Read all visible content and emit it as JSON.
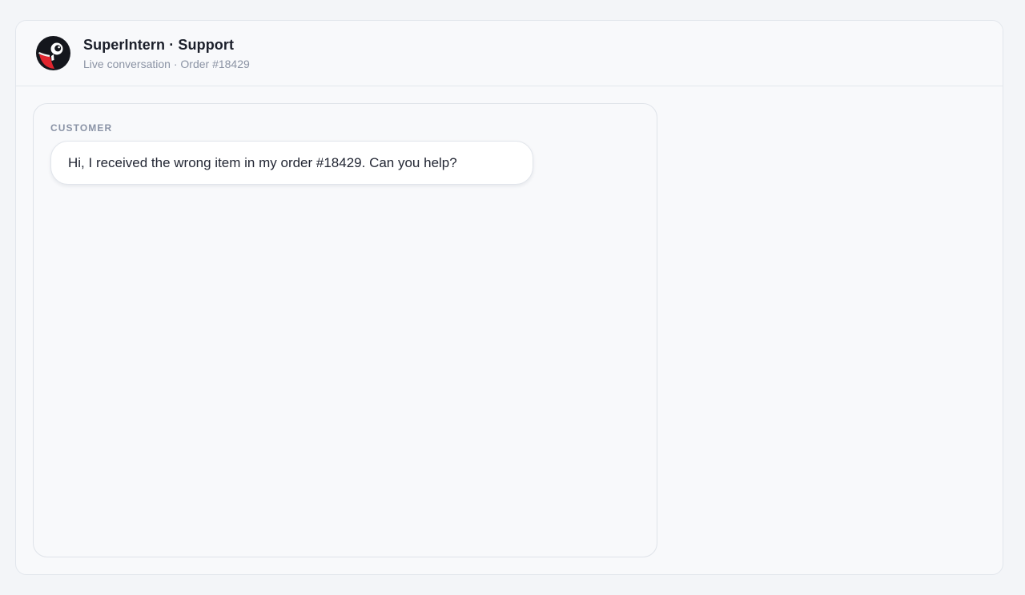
{
  "header": {
    "title": "SuperIntern · Support",
    "subtitle": "Live conversation · Order #18429",
    "avatar_icon": "mascot-eye-icon"
  },
  "conversation": {
    "messages": [
      {
        "sender": "CUSTOMER",
        "text": "Hi, I received the wrong item in my order #18429. Can you help?"
      }
    ]
  },
  "colors": {
    "background": "#f3f5f8",
    "panel": "#f8f9fb",
    "border": "#e2e6ec",
    "bubble": "#ffffff",
    "accent_red": "#e0262f",
    "avatar_dark": "#14161c"
  }
}
